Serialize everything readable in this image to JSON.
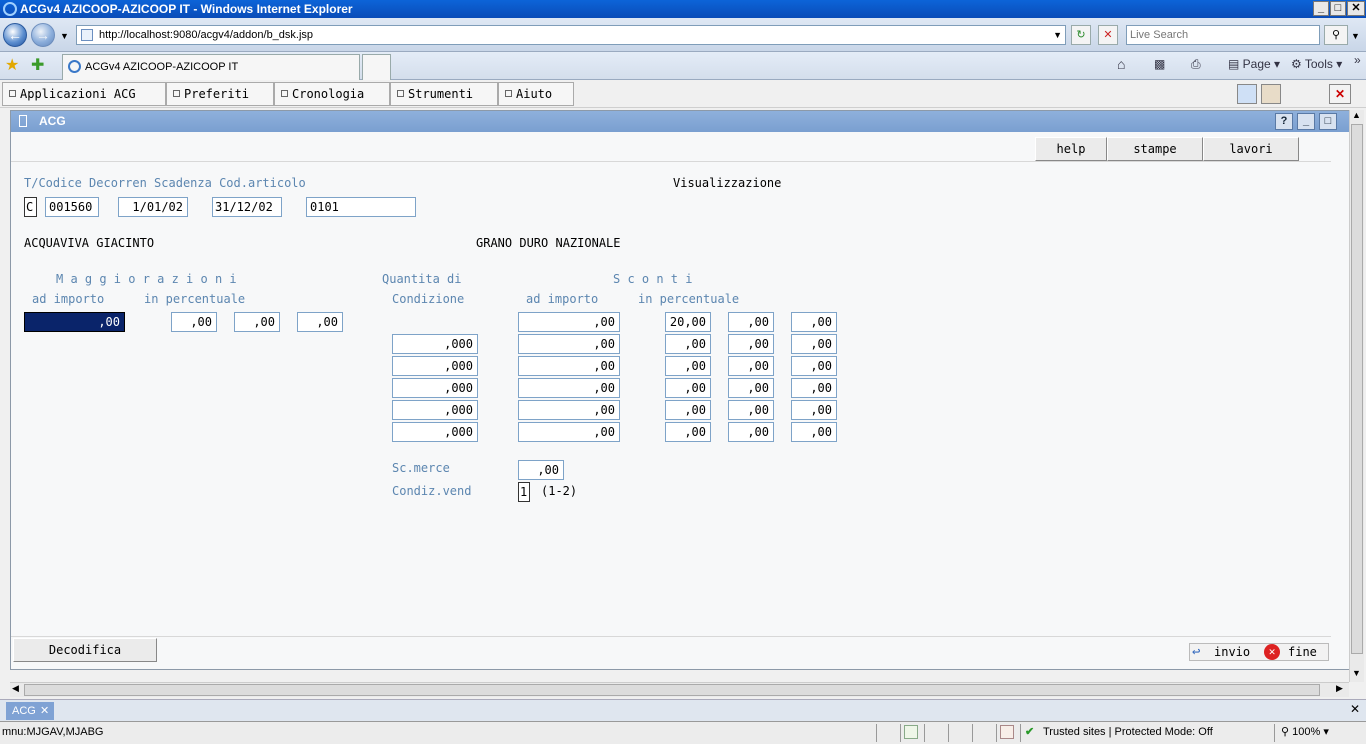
{
  "window": {
    "title": "ACGv4 AZICOOP-AZICOOP IT - Windows Internet Explorer",
    "controls": [
      "_",
      "□",
      "✕"
    ]
  },
  "browser": {
    "url": "http://localhost:9080/acgv4/addon/b_dsk.jsp",
    "search_placeholder": "Live Search",
    "tab_title": "ACGv4 AZICOOP-AZICOOP IT",
    "toolbar": {
      "page_label": "Page",
      "tools_label": "Tools"
    }
  },
  "menu": {
    "items": [
      "Applicazioni ACG",
      "Preferiti",
      "Cronologia",
      "Strumenti",
      "Aiuto"
    ]
  },
  "panel": {
    "title": "ACG",
    "buttons": [
      "?",
      "_",
      "□"
    ]
  },
  "form": {
    "fkeys": {
      "help": "help",
      "stampe": "stampe",
      "lavori": "lavori"
    },
    "header_label": "T/Codice Decorren Scadenza Cod.articolo",
    "mode": "Visualizzazione",
    "tipo": "C",
    "codice": "001560",
    "decorrenza": "1/01/02",
    "scadenza": "31/12/02",
    "cod_articolo": "0101",
    "cliente": "ACQUAVIVA GIACINTO",
    "articolo": "GRANO DURO NAZIONALE",
    "labels": {
      "maggiorazioni": "M a g g i o r a z i o n i",
      "ad_importo": "ad importo",
      "in_percentuale": "in percentuale",
      "quantita_di": "Quantita di",
      "condizione": "Condizione",
      "sconti": "S c o n t i",
      "sconti_ad_importo": "ad importo",
      "sconti_in_percentuale": "in percentuale",
      "sc_merce": "Sc.merce",
      "condiz_vend": "Condiz.vend",
      "condiz_hint": "(1-2)"
    },
    "maggiorazione_importo": ",00",
    "maggiorazione_perc": [
      ",00",
      ",00",
      ",00"
    ],
    "rows": [
      {
        "quantita": null,
        "importo": ",00",
        "perc": [
          "20,00",
          ",00",
          ",00"
        ]
      },
      {
        "quantita": ",000",
        "importo": ",00",
        "perc": [
          ",00",
          ",00",
          ",00"
        ]
      },
      {
        "quantita": ",000",
        "importo": ",00",
        "perc": [
          ",00",
          ",00",
          ",00"
        ]
      },
      {
        "quantita": ",000",
        "importo": ",00",
        "perc": [
          ",00",
          ",00",
          ",00"
        ]
      },
      {
        "quantita": ",000",
        "importo": ",00",
        "perc": [
          ",00",
          ",00",
          ",00"
        ]
      },
      {
        "quantita": ",000",
        "importo": ",00",
        "perc": [
          ",00",
          ",00",
          ",00"
        ]
      }
    ],
    "sc_merce": ",00",
    "condiz_vend": "1",
    "bottom": {
      "decodifica": "Decodifica",
      "invio": "invio",
      "fine": "fine"
    }
  },
  "bottom_tab": {
    "label": "ACG"
  },
  "status": {
    "left": "mnu:MJGAV,MJABG",
    "zone": "Trusted sites | Protected Mode: Off",
    "zoom": "100%"
  }
}
